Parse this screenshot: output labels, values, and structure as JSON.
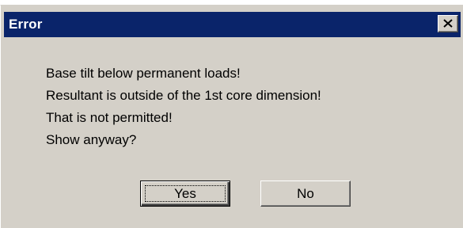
{
  "window": {
    "title": "Error",
    "close_icon": "close-icon"
  },
  "message": {
    "lines": [
      "Base tilt below permanent loads!",
      "Resultant is outside of the 1st core dimension!",
      "That is not permitted!",
      "Show anyway?"
    ]
  },
  "buttons": {
    "yes_label": "Yes",
    "no_label": "No"
  },
  "colors": {
    "title_bar": "#0a246a",
    "dialog_face": "#d4d0c8"
  }
}
